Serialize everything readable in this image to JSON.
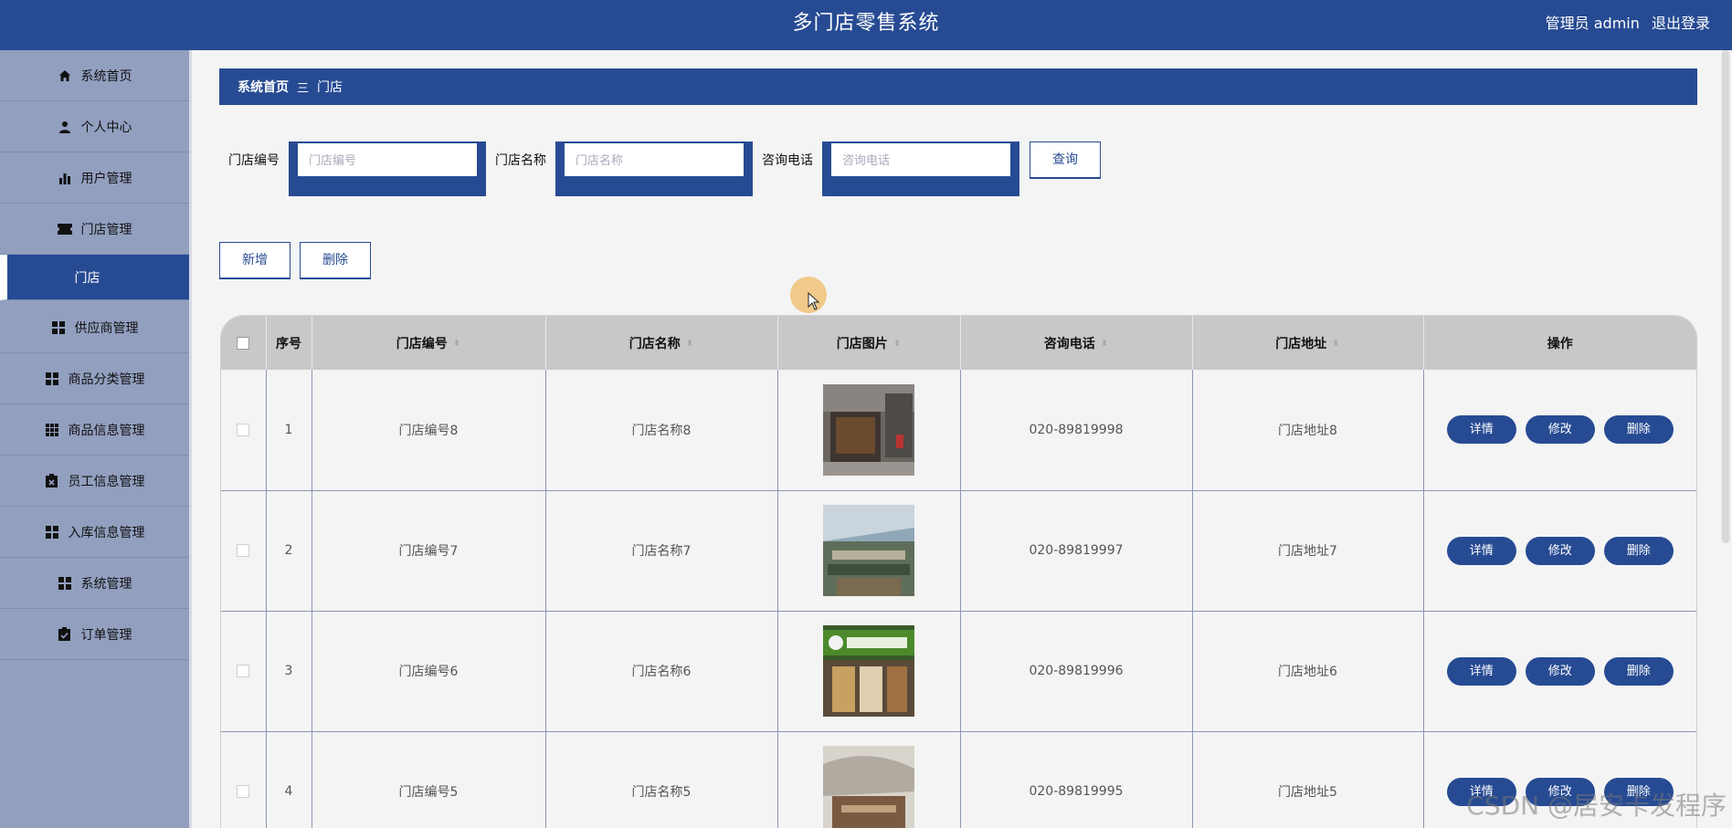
{
  "header": {
    "title": "多门店零售系统",
    "user_label": "管理员 admin",
    "logout_label": "退出登录"
  },
  "sidebar": {
    "items": [
      {
        "label": "系统首页",
        "icon": "home-icon"
      },
      {
        "label": "个人中心",
        "icon": "user-icon"
      },
      {
        "label": "用户管理",
        "icon": "bar-chart-icon"
      },
      {
        "label": "门店管理",
        "icon": "ticket-icon"
      },
      {
        "label": "门店",
        "icon": "",
        "active": true
      },
      {
        "label": "供应商管理",
        "icon": "grid-icon"
      },
      {
        "label": "商品分类管理",
        "icon": "grid-icon"
      },
      {
        "label": "商品信息管理",
        "icon": "grid-9-icon"
      },
      {
        "label": "员工信息管理",
        "icon": "clipboard-x-icon"
      },
      {
        "label": "入库信息管理",
        "icon": "grid-icon"
      },
      {
        "label": "系统管理",
        "icon": "grid-icon"
      },
      {
        "label": "订单管理",
        "icon": "clipboard-check-icon"
      }
    ]
  },
  "breadcrumb": {
    "home": "系统首页",
    "separator": "三",
    "current": "门店"
  },
  "search": {
    "store_no_label": "门店编号",
    "store_no_placeholder": "门店编号",
    "store_name_label": "门店名称",
    "store_name_placeholder": "门店名称",
    "phone_label": "咨询电话",
    "phone_placeholder": "咨询电话",
    "query_label": "查询"
  },
  "actions": {
    "add_label": "新增",
    "delete_label": "删除"
  },
  "table": {
    "headers": {
      "index": "序号",
      "store_no": "门店编号",
      "store_name": "门店名称",
      "store_image": "门店图片",
      "phone": "咨询电话",
      "address": "门店地址",
      "ops": "操作"
    },
    "rows": [
      {
        "index": "1",
        "store_no": "门店编号8",
        "store_name": "门店名称8",
        "phone": "020-89819998",
        "address": "门店地址8"
      },
      {
        "index": "2",
        "store_no": "门店编号7",
        "store_name": "门店名称7",
        "phone": "020-89819997",
        "address": "门店地址7"
      },
      {
        "index": "3",
        "store_no": "门店编号6",
        "store_name": "门店名称6",
        "phone": "020-89819996",
        "address": "门店地址6"
      },
      {
        "index": "4",
        "store_no": "门店编号5",
        "store_name": "门店名称5",
        "phone": "020-89819995",
        "address": "门店地址5"
      }
    ],
    "row_buttons": {
      "detail": "详情",
      "edit": "修改",
      "delete": "删除"
    }
  },
  "watermark": "CSDN @居安卡发程序"
}
